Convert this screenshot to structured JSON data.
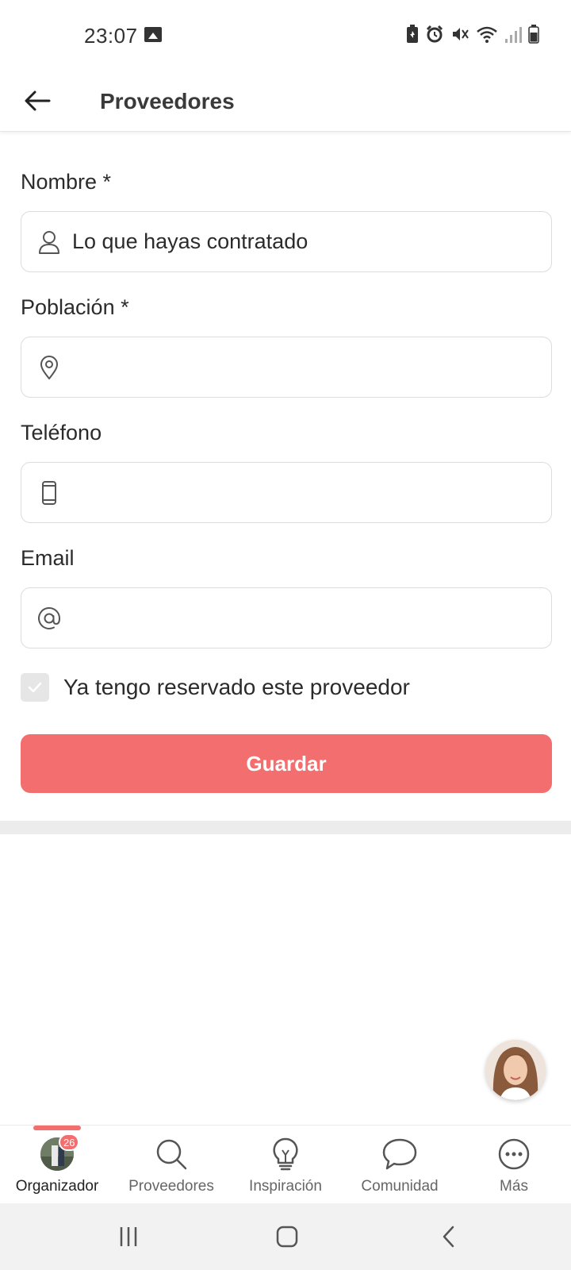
{
  "status_bar": {
    "time": "23:07",
    "icons": [
      "gallery-icon",
      "battery-saver-icon",
      "alarm-icon",
      "mute-icon",
      "wifi-icon",
      "signal-icon",
      "battery-icon"
    ]
  },
  "header": {
    "title": "Proveedores",
    "back_icon": "arrow-left-icon"
  },
  "form": {
    "name": {
      "label": "Nombre *",
      "value": "Lo que hayas contratado",
      "icon": "person-icon"
    },
    "location": {
      "label": "Población *",
      "value": "",
      "icon": "location-pin-icon"
    },
    "phone": {
      "label": "Teléfono",
      "value": "",
      "icon": "phone-icon"
    },
    "email": {
      "label": "Email",
      "value": "",
      "icon": "at-icon"
    },
    "booked_checkbox": {
      "label": "Ya tengo reservado este proveedor",
      "checked": true
    },
    "save_label": "Guardar"
  },
  "bottom_nav": {
    "items": [
      {
        "label": "Organizador",
        "icon": "avatar",
        "badge": "26",
        "active": true
      },
      {
        "label": "Proveedores",
        "icon": "search-icon",
        "active": false
      },
      {
        "label": "Inspiración",
        "icon": "lightbulb-icon",
        "active": false
      },
      {
        "label": "Comunidad",
        "icon": "chat-bubble-icon",
        "active": false
      },
      {
        "label": "Más",
        "icon": "more-icon",
        "active": false
      }
    ]
  },
  "colors": {
    "accent": "#f36f6f",
    "text": "#2b2b2b",
    "border": "#dcdcdc",
    "divider": "#ececec"
  }
}
